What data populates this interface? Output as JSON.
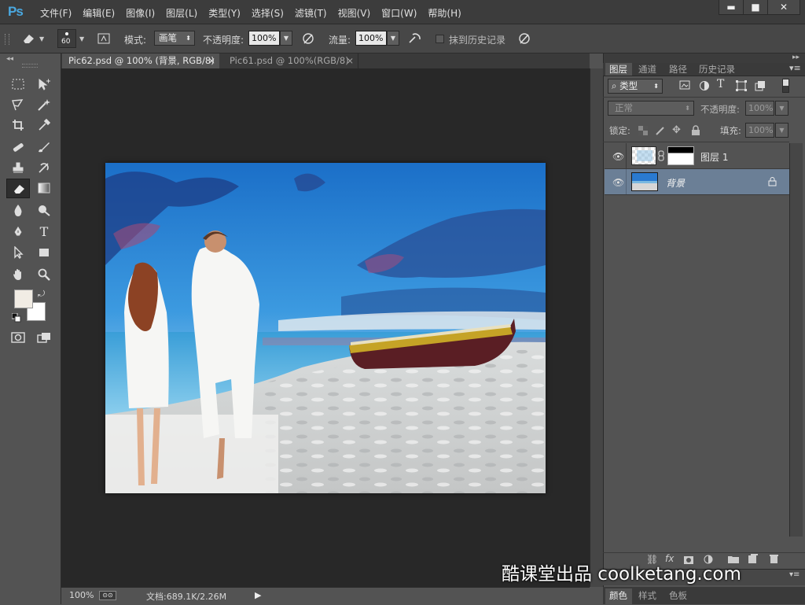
{
  "app": {
    "logo": "Ps"
  },
  "menu": [
    "文件(F)",
    "编辑(E)",
    "图像(I)",
    "图层(L)",
    "类型(Y)",
    "选择(S)",
    "滤镜(T)",
    "视图(V)",
    "窗口(W)",
    "帮助(H)"
  ],
  "window_buttons": {
    "minimize": "▬",
    "maximize": "■",
    "close": "✕"
  },
  "options": {
    "brush_size": "60",
    "mode_label": "模式:",
    "mode_value": "画笔",
    "opacity_label": "不透明度:",
    "opacity_value": "100%",
    "flow_label": "流量:",
    "flow_value": "100%",
    "erase_history_label": "抹到历史记录"
  },
  "tabs": [
    {
      "label": "Pic62.psd @ 100% (背景, RGB/8)",
      "close": "×",
      "active": true
    },
    {
      "label": "Pic61.psd @ 100%(RGB/8)",
      "close": "×",
      "active": false
    }
  ],
  "status": {
    "zoom": "100%",
    "doc_info": "文档:689.1K/2.26M"
  },
  "panels": {
    "tabs": [
      "图层",
      "通道",
      "路径",
      "历史记录"
    ],
    "filter_kind": "类型",
    "blend_mode": "正常",
    "opacity_label": "不透明度:",
    "opacity_value": "100%",
    "lock_label": "锁定:",
    "fill_label": "填充:",
    "fill_value": "100%",
    "layers": [
      {
        "name": "图层 1",
        "selected": false
      },
      {
        "name": "背景",
        "selected": true
      }
    ],
    "bottom_tabs": [
      "颜色",
      "样式",
      "色板"
    ]
  },
  "watermark": "酷课堂出品 coolketang.com",
  "colors": {
    "selected_layer": "#6b7f96",
    "canvas_bg": "#282828",
    "menubar": "#3c3c3c"
  }
}
